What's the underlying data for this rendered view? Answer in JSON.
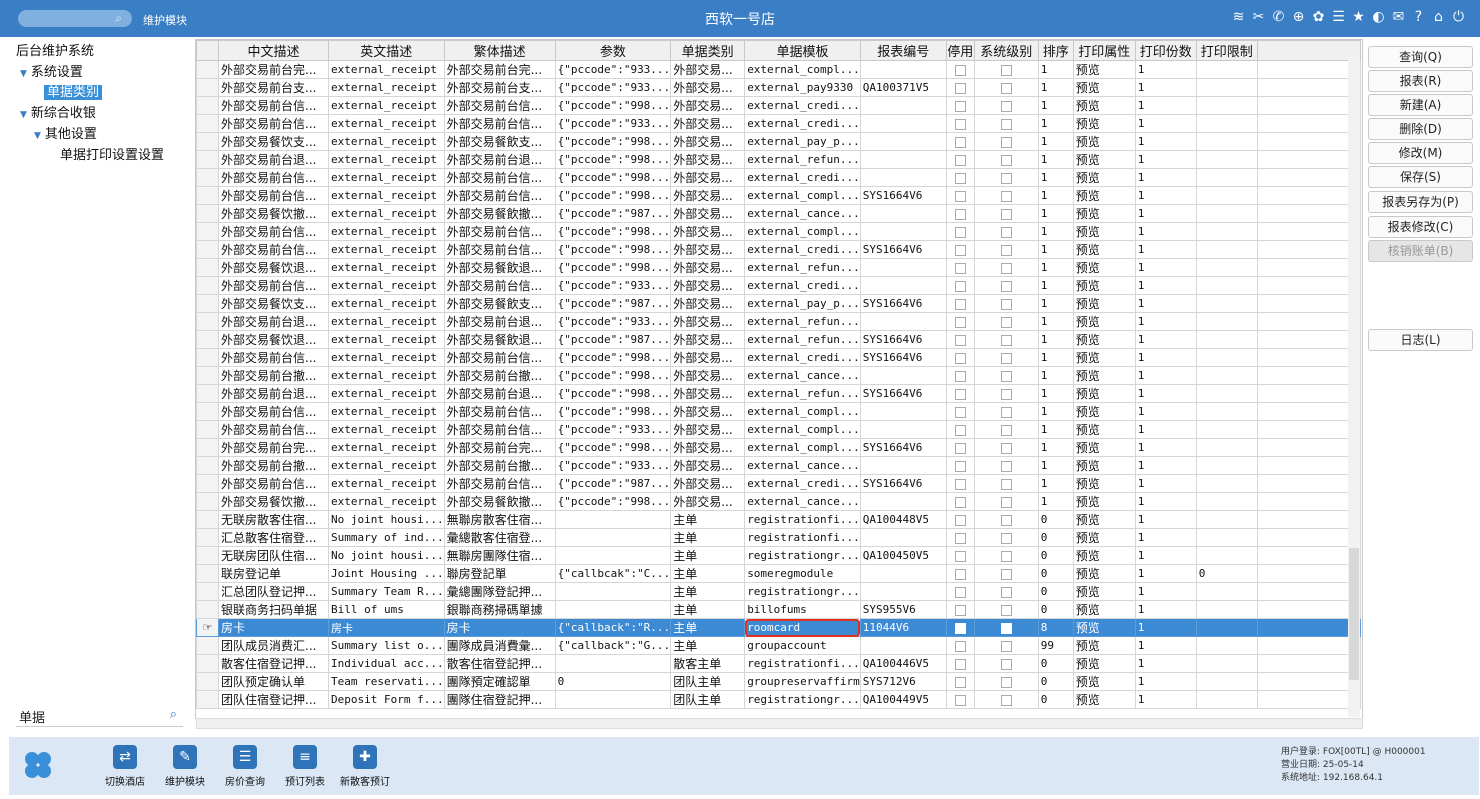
{
  "topbar": {
    "module": "维护模块",
    "title": "西软一号店",
    "accent": "#3a7ec5"
  },
  "tree": {
    "root": "后台维护系统",
    "items": [
      {
        "label": "系统设置",
        "level": 1,
        "expanded": true
      },
      {
        "label": "单据类别",
        "level": 2,
        "selected": true
      },
      {
        "label": "新综合收银",
        "level": 1,
        "expanded": true
      },
      {
        "label": "其他设置",
        "level": 2,
        "expanded": true
      },
      {
        "label": "单据打印设置设置",
        "level": 3
      }
    ],
    "search_value": "单据"
  },
  "grid": {
    "columns": [
      "中文描述",
      "英文描述",
      "繁体描述",
      "参数",
      "单据类别",
      "单据模板",
      "报表编号",
      "停用",
      "系统级别",
      "排序",
      "打印属性",
      "打印份数",
      "打印限制"
    ],
    "rows": [
      [
        "外部交易前台完...",
        "external_receipt",
        "外部交易前台完...",
        "{\"pccode\":\"933...",
        "外部交易...",
        "external_compl...",
        "",
        false,
        false,
        "1",
        "预览",
        "1",
        ""
      ],
      [
        "外部交易前台支...",
        "external_receipt",
        "外部交易前台支...",
        "{\"pccode\":\"933...",
        "外部交易...",
        "external_pay9330",
        "QA100371V5",
        false,
        false,
        "1",
        "预览",
        "1",
        ""
      ],
      [
        "外部交易前台信...",
        "external_receipt",
        "外部交易前台信...",
        "{\"pccode\":\"998...",
        "外部交易...",
        "external_credi...",
        "",
        false,
        false,
        "1",
        "预览",
        "1",
        ""
      ],
      [
        "外部交易前台信...",
        "external_receipt",
        "外部交易前台信...",
        "{\"pccode\":\"933...",
        "外部交易...",
        "external_credi...",
        "",
        false,
        false,
        "1",
        "预览",
        "1",
        ""
      ],
      [
        "外部交易餐饮支...",
        "external_receipt",
        "外部交易餐飲支...",
        "{\"pccode\":\"998...",
        "外部交易...",
        "external_pay_p...",
        "",
        false,
        false,
        "1",
        "预览",
        "1",
        ""
      ],
      [
        "外部交易前台退...",
        "external_receipt",
        "外部交易前台退...",
        "{\"pccode\":\"998...",
        "外部交易...",
        "external_refun...",
        "",
        false,
        false,
        "1",
        "预览",
        "1",
        ""
      ],
      [
        "外部交易前台信...",
        "external_receipt",
        "外部交易前台信...",
        "{\"pccode\":\"998...",
        "外部交易...",
        "external_credi...",
        "",
        false,
        false,
        "1",
        "预览",
        "1",
        ""
      ],
      [
        "外部交易前台信...",
        "external_receipt",
        "外部交易前台信...",
        "{\"pccode\":\"998...",
        "外部交易...",
        "external_compl...",
        "SYS1664V6",
        false,
        false,
        "1",
        "预览",
        "1",
        ""
      ],
      [
        "外部交易餐饮撤...",
        "external_receipt",
        "外部交易餐飲撤...",
        "{\"pccode\":\"987...",
        "外部交易...",
        "external_cance...",
        "",
        false,
        false,
        "1",
        "预览",
        "1",
        ""
      ],
      [
        "外部交易前台信...",
        "external_receipt",
        "外部交易前台信...",
        "{\"pccode\":\"998...",
        "外部交易...",
        "external_compl...",
        "",
        false,
        false,
        "1",
        "预览",
        "1",
        ""
      ],
      [
        "外部交易前台信...",
        "external_receipt",
        "外部交易前台信...",
        "{\"pccode\":\"998...",
        "外部交易...",
        "external_credi...",
        "SYS1664V6",
        false,
        false,
        "1",
        "预览",
        "1",
        ""
      ],
      [
        "外部交易餐饮退...",
        "external_receipt",
        "外部交易餐飲退...",
        "{\"pccode\":\"998...",
        "外部交易...",
        "external_refun...",
        "",
        false,
        false,
        "1",
        "预览",
        "1",
        ""
      ],
      [
        "外部交易前台信...",
        "external_receipt",
        "外部交易前台信...",
        "{\"pccode\":\"933...",
        "外部交易...",
        "external_credi...",
        "",
        false,
        false,
        "1",
        "预览",
        "1",
        ""
      ],
      [
        "外部交易餐饮支...",
        "external_receipt",
        "外部交易餐飲支...",
        "{\"pccode\":\"987...",
        "外部交易...",
        "external_pay_p...",
        "SYS1664V6",
        false,
        false,
        "1",
        "预览",
        "1",
        ""
      ],
      [
        "外部交易前台退...",
        "external_receipt",
        "外部交易前台退...",
        "{\"pccode\":\"933...",
        "外部交易...",
        "external_refun...",
        "",
        false,
        false,
        "1",
        "预览",
        "1",
        ""
      ],
      [
        "外部交易餐饮退...",
        "external_receipt",
        "外部交易餐飲退...",
        "{\"pccode\":\"987...",
        "外部交易...",
        "external_refun...",
        "SYS1664V6",
        false,
        false,
        "1",
        "预览",
        "1",
        ""
      ],
      [
        "外部交易前台信...",
        "external_receipt",
        "外部交易前台信...",
        "{\"pccode\":\"998...",
        "外部交易...",
        "external_credi...",
        "SYS1664V6",
        false,
        false,
        "1",
        "预览",
        "1",
        ""
      ],
      [
        "外部交易前台撤...",
        "external_receipt",
        "外部交易前台撤...",
        "{\"pccode\":\"998...",
        "外部交易...",
        "external_cance...",
        "",
        false,
        false,
        "1",
        "预览",
        "1",
        ""
      ],
      [
        "外部交易前台退...",
        "external_receipt",
        "外部交易前台退...",
        "{\"pccode\":\"998...",
        "外部交易...",
        "external_refun...",
        "SYS1664V6",
        false,
        false,
        "1",
        "预览",
        "1",
        ""
      ],
      [
        "外部交易前台信...",
        "external_receipt",
        "外部交易前台信...",
        "{\"pccode\":\"998...",
        "外部交易...",
        "external_compl...",
        "",
        false,
        false,
        "1",
        "预览",
        "1",
        ""
      ],
      [
        "外部交易前台信...",
        "external_receipt",
        "外部交易前台信...",
        "{\"pccode\":\"933...",
        "外部交易...",
        "external_compl...",
        "",
        false,
        false,
        "1",
        "预览",
        "1",
        ""
      ],
      [
        "外部交易前台完...",
        "external_receipt",
        "外部交易前台完...",
        "{\"pccode\":\"998...",
        "外部交易...",
        "external_compl...",
        "SYS1664V6",
        false,
        false,
        "1",
        "预览",
        "1",
        ""
      ],
      [
        "外部交易前台撤...",
        "external_receipt",
        "外部交易前台撤...",
        "{\"pccode\":\"933...",
        "外部交易...",
        "external_cance...",
        "",
        false,
        false,
        "1",
        "预览",
        "1",
        ""
      ],
      [
        "外部交易前台信...",
        "external_receipt",
        "外部交易前台信...",
        "{\"pccode\":\"987...",
        "外部交易...",
        "external_credi...",
        "SYS1664V6",
        false,
        false,
        "1",
        "预览",
        "1",
        ""
      ],
      [
        "外部交易餐饮撤...",
        "external_receipt",
        "外部交易餐飲撤...",
        "{\"pccode\":\"998...",
        "外部交易...",
        "external_cance...",
        "",
        false,
        false,
        "1",
        "预览",
        "1",
        ""
      ],
      [
        "无联房散客住宿...",
        "No joint housi...",
        "無聯房散客住宿...",
        "",
        "主单",
        "registrationfi...",
        "QA100448V5",
        false,
        false,
        "0",
        "预览",
        "1",
        ""
      ],
      [
        "汇总散客住宿登...",
        "Summary of ind...",
        "彙總散客住宿登...",
        "",
        "主单",
        "registrationfi...",
        "",
        false,
        false,
        "0",
        "预览",
        "1",
        ""
      ],
      [
        "无联房团队住宿...",
        "No joint housi...",
        "無聯房團隊住宿...",
        "",
        "主单",
        "registrationgr...",
        "QA100450V5",
        false,
        false,
        "0",
        "预览",
        "1",
        ""
      ],
      [
        "联房登记单",
        "Joint Housing ...",
        "聯房登記單",
        "{\"callbcak\":\"C...",
        "主单",
        "someregmodule",
        "",
        false,
        false,
        "0",
        "预览",
        "1",
        "0"
      ],
      [
        "汇总团队登记押...",
        "Summary Team R...",
        "彙總團隊登記押...",
        "",
        "主单",
        "registrationgr...",
        "",
        false,
        false,
        "0",
        "预览",
        "1",
        ""
      ],
      [
        "银联商务扫码单据",
        "Bill of ums",
        "銀聯商務掃碼單據",
        "",
        "主单",
        "billofums",
        "SYS955V6",
        false,
        false,
        "0",
        "预览",
        "1",
        ""
      ],
      [
        "房卡",
        "房卡",
        "房卡",
        "{\"callback\":\"R...",
        "主单",
        "roomcard",
        "11044V6",
        false,
        false,
        "8",
        "预览",
        "1",
        ""
      ],
      [
        "团队成员消费汇...",
        "Summary list o...",
        "團隊成員消費彙...",
        "{\"callback\":\"G...",
        "主单",
        "groupaccount",
        "",
        false,
        false,
        "99",
        "预览",
        "1",
        ""
      ],
      [
        "散客住宿登记押...",
        "Individual acc...",
        "散客住宿登記押...",
        "",
        "散客主单",
        "registrationfi...",
        "QA100446V5",
        false,
        false,
        "0",
        "预览",
        "1",
        ""
      ],
      [
        "团队预定确认单",
        "Team reservati...",
        "團隊預定確認單",
        "0",
        "团队主单",
        "groupreservaffirm",
        "SYS712V6",
        false,
        false,
        "0",
        "预览",
        "1",
        ""
      ],
      [
        "团队住宿登记押...",
        "Deposit Form f...",
        "團隊住宿登記押...",
        "",
        "团队主单",
        "registrationgr...",
        "QA100449V5",
        false,
        false,
        "0",
        "预览",
        "1",
        ""
      ]
    ],
    "selected_row": 31,
    "selected_color": "#3d8ad4",
    "highlight_color": "#e0301e"
  },
  "buttons": [
    {
      "label": "查询(Q)",
      "enabled": true
    },
    {
      "label": "报表(R)",
      "enabled": true
    },
    {
      "label": "新建(A)",
      "enabled": true
    },
    {
      "label": "删除(D)",
      "enabled": true
    },
    {
      "label": "修改(M)",
      "enabled": true
    },
    {
      "label": "保存(S)",
      "enabled": true
    },
    {
      "label": "报表另存为(P)",
      "enabled": true
    },
    {
      "label": "报表修改(C)",
      "enabled": true
    },
    {
      "label": "核销账单(B)",
      "enabled": false
    },
    {
      "label": "日志(L)",
      "enabled": true
    }
  ],
  "dock": {
    "items": [
      {
        "label": "切换酒店",
        "icon": "switch-hotel-icon"
      },
      {
        "label": "维护模块",
        "icon": "maintenance-icon"
      },
      {
        "label": "房价查询",
        "icon": "rate-query-icon"
      },
      {
        "label": "预订列表",
        "icon": "reservation-list-icon"
      },
      {
        "label": "新散客预订",
        "icon": "new-guest-booking-icon"
      }
    ],
    "status": {
      "user": "用户登录:  FOX[00TL] @ H000001",
      "date": "营业日期:  25-05-14",
      "ip": "系统地址:  192.168.64.1"
    }
  }
}
